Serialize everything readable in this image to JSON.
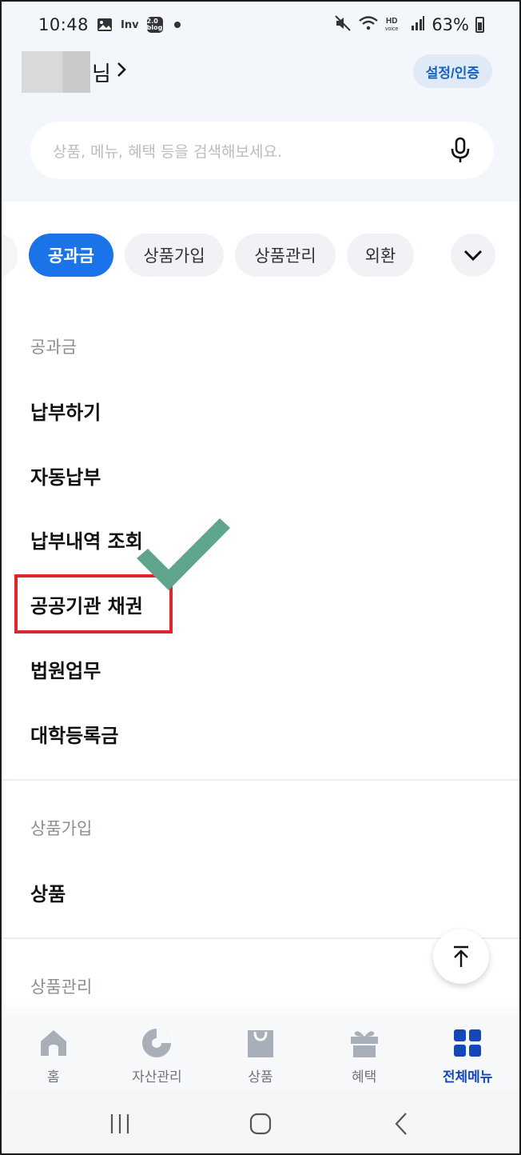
{
  "status_bar": {
    "time": "10:48",
    "inv_label": "Inv",
    "blog_label": "2.0 blog",
    "battery": "63%"
  },
  "header": {
    "user_suffix": "님",
    "settings_label": "설정/인증"
  },
  "search": {
    "placeholder": "상품, 메뉴, 혜택 등을 검색해보세요."
  },
  "chips": [
    {
      "label": "공과금",
      "active": true
    },
    {
      "label": "상품가입",
      "active": false
    },
    {
      "label": "상품관리",
      "active": false
    },
    {
      "label": "외환",
      "active": false
    }
  ],
  "sections": [
    {
      "title": "공과금",
      "items": [
        "납부하기",
        "자동납부",
        "납부내역 조회",
        "공공기관 채권",
        "법원업무",
        "대학등록금"
      ]
    },
    {
      "title": "상품가입",
      "items": [
        "상품"
      ]
    },
    {
      "title": "상품관리",
      "items": []
    }
  ],
  "bottom_nav": [
    {
      "label": "홈",
      "icon": "home-icon",
      "active": false
    },
    {
      "label": "자산관리",
      "icon": "pie-chart-icon",
      "active": false
    },
    {
      "label": "상품",
      "icon": "shopping-bag-icon",
      "active": false
    },
    {
      "label": "혜택",
      "icon": "gift-icon",
      "active": false
    },
    {
      "label": "전체메뉴",
      "icon": "grid-menu-icon",
      "active": true
    }
  ],
  "colors": {
    "accent": "#1a73e8",
    "nav_active": "#1547b8",
    "highlight": "#e0242b",
    "checkmark": "#5fa48c"
  }
}
